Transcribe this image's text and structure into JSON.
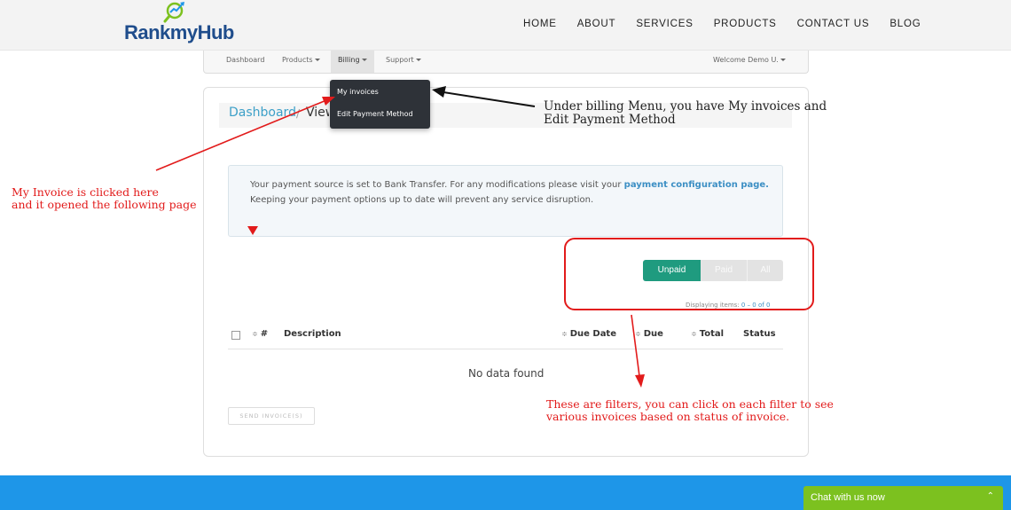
{
  "brand": {
    "logo_text_1": "Rank",
    "logo_text_2": "my",
    "logo_text_3": "Hub"
  },
  "main_nav": [
    "HOME",
    "ABOUT",
    "SERVICES",
    "PRODUCTS",
    "CONTACT US",
    "BLOG"
  ],
  "app_nav": {
    "dashboard": "Dashboard",
    "products": "Products",
    "billing": "Billing",
    "support": "Support",
    "welcome": "Welcome Demo U."
  },
  "billing_menu": {
    "item_1": "My invoices",
    "item_2": "Edit Payment Method"
  },
  "breadcrumb": {
    "link": "Dashboard",
    "separator": "/",
    "current": "View"
  },
  "alert": {
    "line_1_text": "Your payment source is set to Bank Transfer. For any modifications please visit your ",
    "line_1_link": "payment configuration page.",
    "line_2": "Keeping your payment options up to date will prevent any service disruption."
  },
  "filters": {
    "unpaid": "Unpaid",
    "paid": "Paid",
    "all": "All"
  },
  "displaying": {
    "prefix": "Displaying items: ",
    "range": "0 – 0 of 0"
  },
  "table": {
    "sort_glyph": "≑",
    "columns": {
      "num": "#",
      "description": "Description",
      "due_date": "Due Date",
      "due": "Due",
      "total": "Total",
      "status": "Status"
    },
    "empty": "No data found"
  },
  "send_button": "SEND INVOICE(S)",
  "annotations": {
    "billing_menu_1": "Under billing Menu, you have My invoices and",
    "billing_menu_2": "Edit Payment Method",
    "invoice_clicked_1": "My Invoice is clicked here",
    "invoice_clicked_2": "and it opened the following page",
    "filters_1": "These are filters, you can click on each filter to see",
    "filters_2": "various invoices based on status of invoice."
  },
  "chat": {
    "label": "Chat with us now",
    "icon": "chevron-up-icon"
  },
  "colors": {
    "accent_green": "#1f9b7f",
    "link_blue": "#3da0c8",
    "footer_blue": "#1e96e8",
    "chat_green": "#7cc11f",
    "annotation_red": "#e21b1b",
    "logo_navy": "#1f4d8c"
  }
}
